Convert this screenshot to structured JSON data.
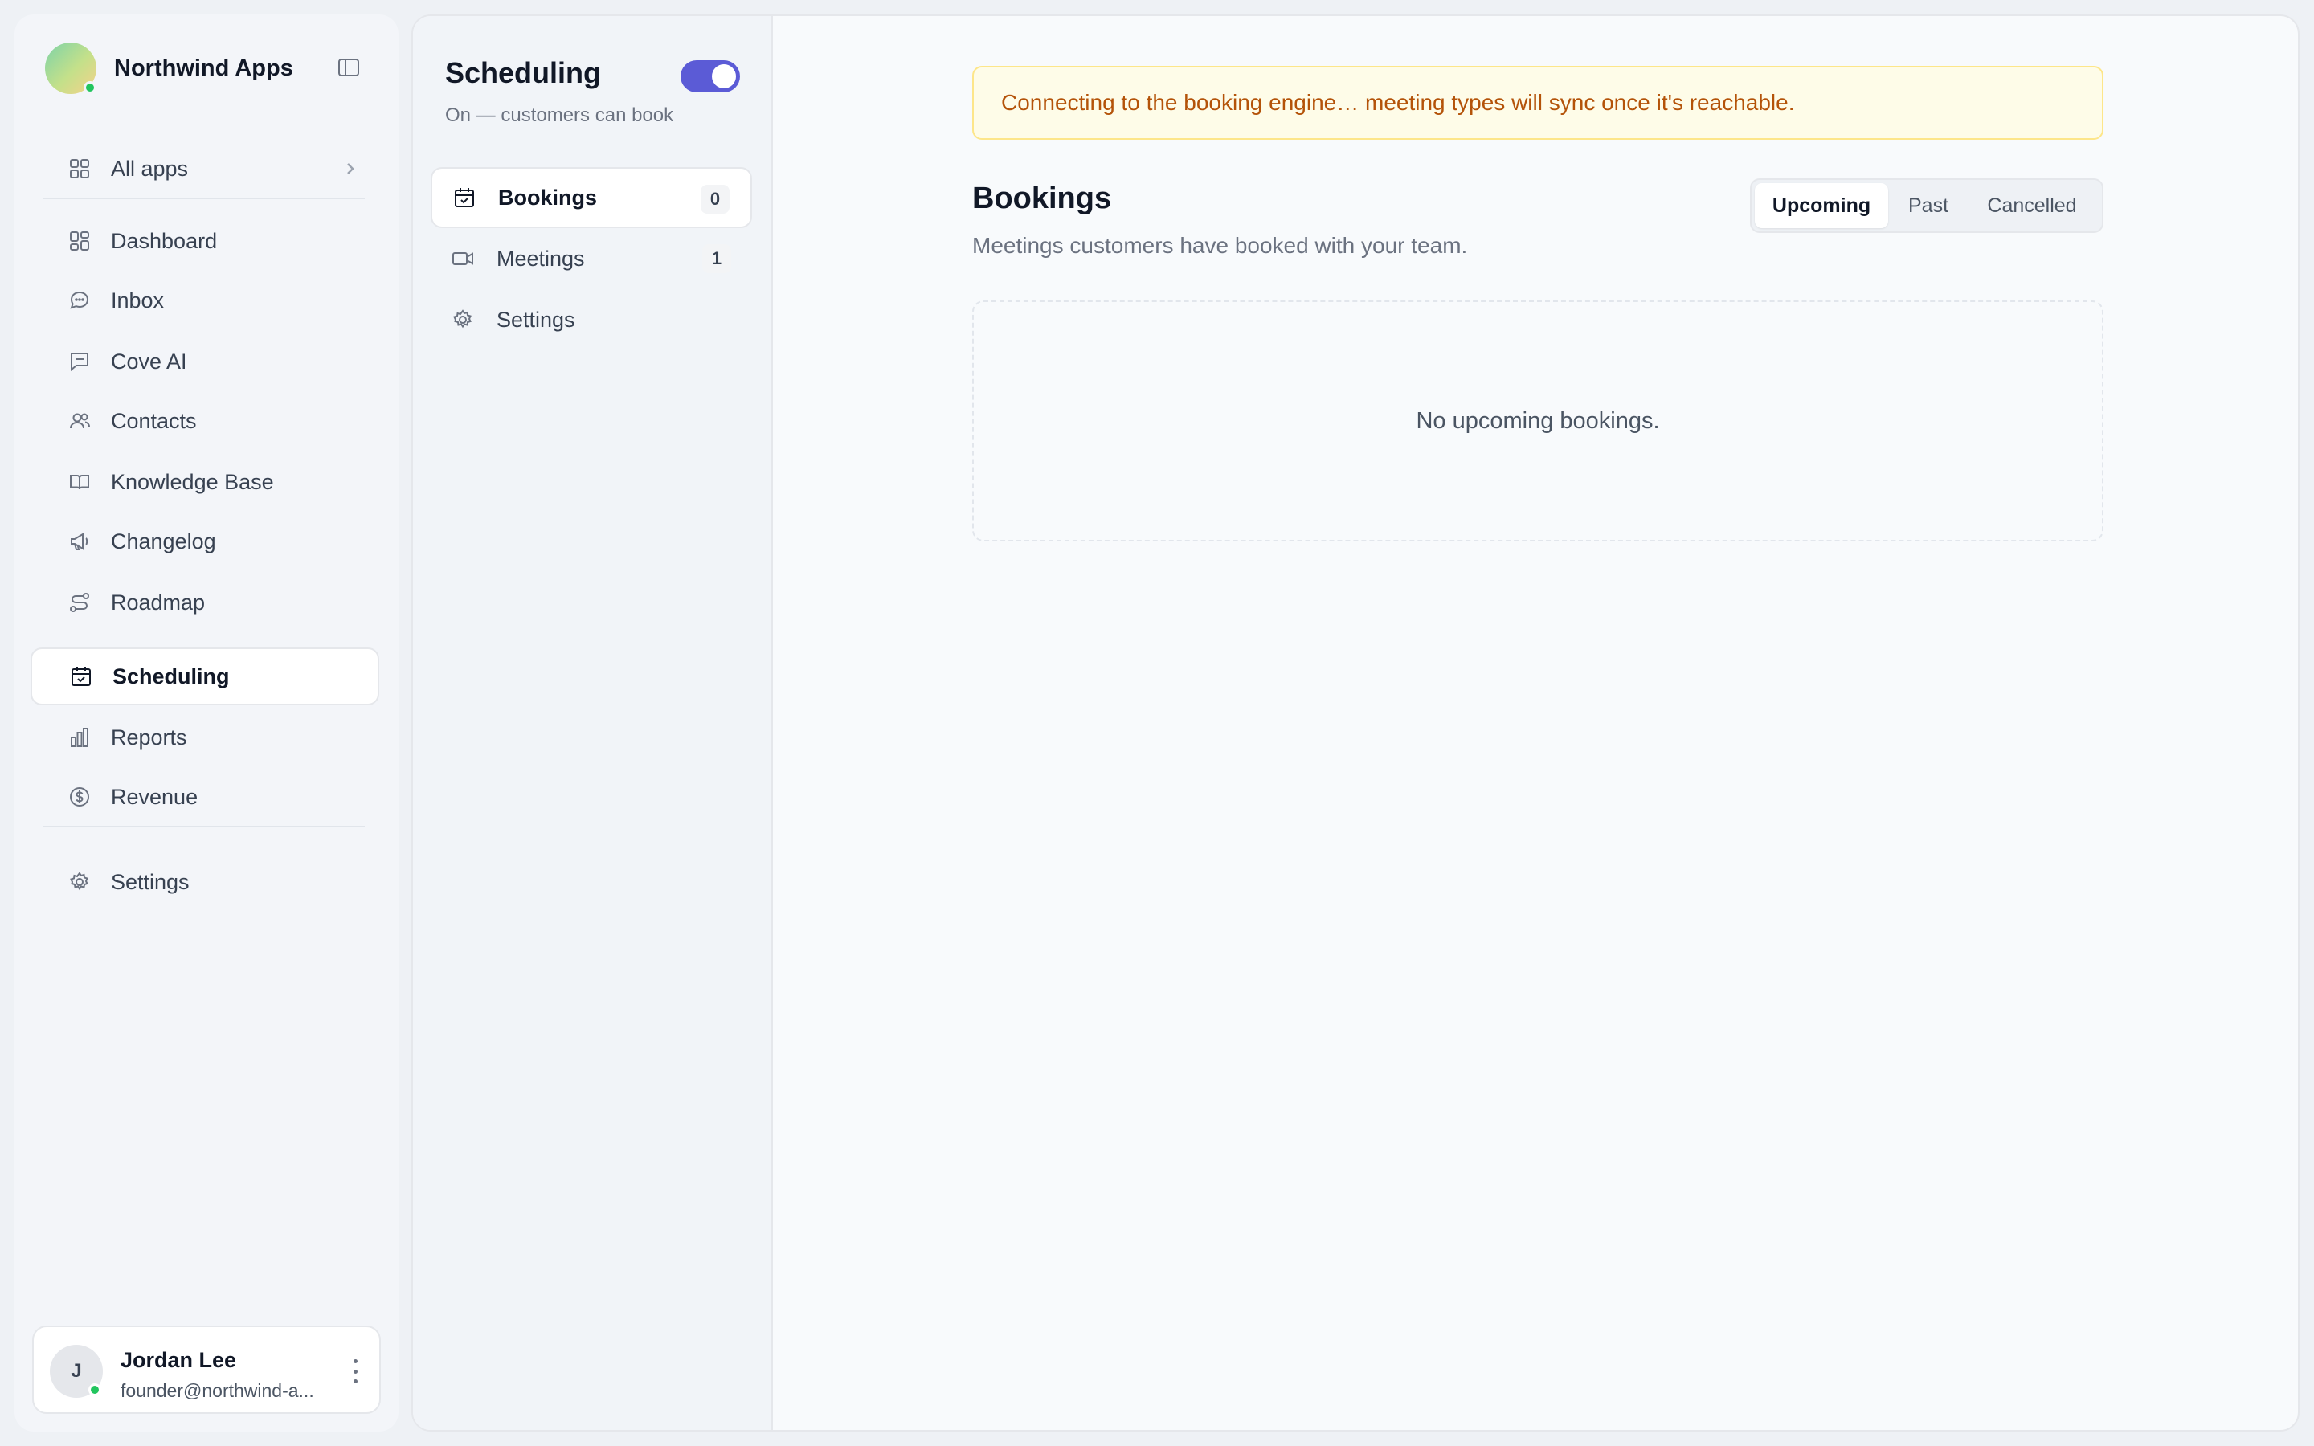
{
  "brand": {
    "name": "Northwind Apps"
  },
  "sidebar": {
    "all_apps": "All apps",
    "items": [
      {
        "label": "Dashboard",
        "icon": "dashboard-icon"
      },
      {
        "label": "Inbox",
        "icon": "chat-icon"
      },
      {
        "label": "Cove AI",
        "icon": "message-square-icon"
      },
      {
        "label": "Contacts",
        "icon": "users-icon"
      },
      {
        "label": "Knowledge Base",
        "icon": "book-icon"
      },
      {
        "label": "Changelog",
        "icon": "megaphone-icon"
      },
      {
        "label": "Roadmap",
        "icon": "route-icon"
      },
      {
        "label": "Scheduling",
        "icon": "calendar-check-icon",
        "active": true
      },
      {
        "label": "Reports",
        "icon": "bar-chart-icon"
      },
      {
        "label": "Revenue",
        "icon": "dollar-circle-icon"
      }
    ],
    "settings": "Settings"
  },
  "user": {
    "initial": "J",
    "name": "Jordan Lee",
    "email": "founder@northwind-a..."
  },
  "subnav": {
    "title": "Scheduling",
    "toggle_on": true,
    "subtitle": "On — customers can book",
    "items": [
      {
        "label": "Bookings",
        "count": "0",
        "icon": "calendar-check-icon",
        "active": true
      },
      {
        "label": "Meetings",
        "count": "1",
        "icon": "video-icon"
      },
      {
        "label": "Settings",
        "icon": "gear-icon"
      }
    ]
  },
  "main": {
    "alert": "Connecting to the booking engine… meeting types will sync once it's reachable.",
    "title": "Bookings",
    "subtitle": "Meetings customers have booked with your team.",
    "tabs": [
      "Upcoming",
      "Past",
      "Cancelled"
    ],
    "active_tab": "Upcoming",
    "empty_text": "No upcoming bookings."
  },
  "colors": {
    "accent": "#5b5bd6",
    "alert_text": "#b45309",
    "online": "#22c55e"
  }
}
